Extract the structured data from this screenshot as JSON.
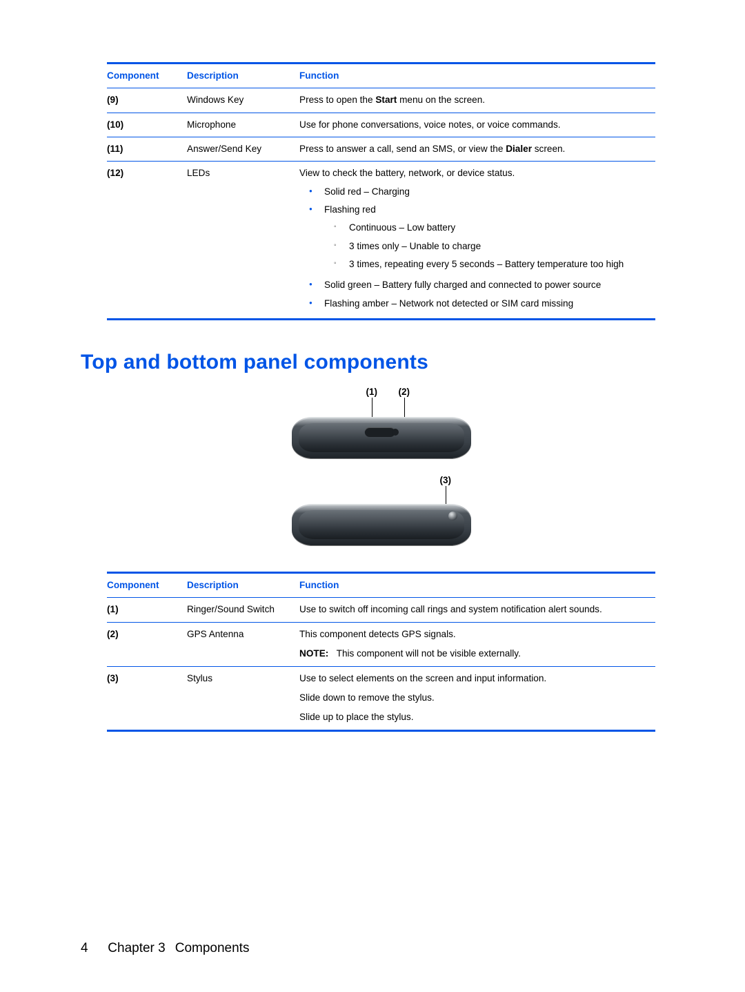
{
  "table1": {
    "headers": {
      "component": "Component",
      "description": "Description",
      "function": "Function"
    },
    "rows": [
      {
        "num": "(9)",
        "desc": "Windows Key",
        "func_pre": "Press to open the ",
        "func_bold": "Start",
        "func_post": " menu on the screen."
      },
      {
        "num": "(10)",
        "desc": "Microphone",
        "func_plain": "Use for phone conversations, voice notes, or voice commands."
      },
      {
        "num": "(11)",
        "desc": "Answer/Send Key",
        "func_pre": "Press to answer a call, send an SMS, or view the ",
        "func_bold": "Dialer",
        "func_post": " screen."
      },
      {
        "num": "(12)",
        "desc": "LEDs",
        "func_plain": "View to check the battery, network, or device status.",
        "bullets": {
          "b1": "Solid red – Charging",
          "b2": "Flashing red",
          "b2_sub": {
            "s1": "Continuous – Low battery",
            "s2": "3 times only – Unable to charge",
            "s3": "3 times, repeating every 5 seconds – Battery temperature too high"
          },
          "b3": "Solid green – Battery fully charged and connected to power source",
          "b4": "Flashing amber – Network not detected or SIM card missing"
        }
      }
    ]
  },
  "section_heading": "Top and bottom panel components",
  "diagram": {
    "callouts": {
      "c1": "(1)",
      "c2": "(2)",
      "c3": "(3)"
    }
  },
  "table2": {
    "headers": {
      "component": "Component",
      "description": "Description",
      "function": "Function"
    },
    "rows": [
      {
        "num": "(1)",
        "desc": "Ringer/Sound Switch",
        "func_plain": "Use to switch off incoming call rings and system notification alert sounds."
      },
      {
        "num": "(2)",
        "desc": "GPS Antenna",
        "func_l1": "This component detects GPS signals.",
        "note_label": "NOTE:",
        "note_text": "This component will not be visible externally."
      },
      {
        "num": "(3)",
        "desc": "Stylus",
        "func_l1": "Use to select elements on the screen and input information.",
        "func_l2": "Slide down to remove the stylus.",
        "func_l3": "Slide up to place the stylus."
      }
    ]
  },
  "footer": {
    "page_number": "4",
    "chapter_label": "Chapter 3",
    "chapter_title": "Components"
  }
}
